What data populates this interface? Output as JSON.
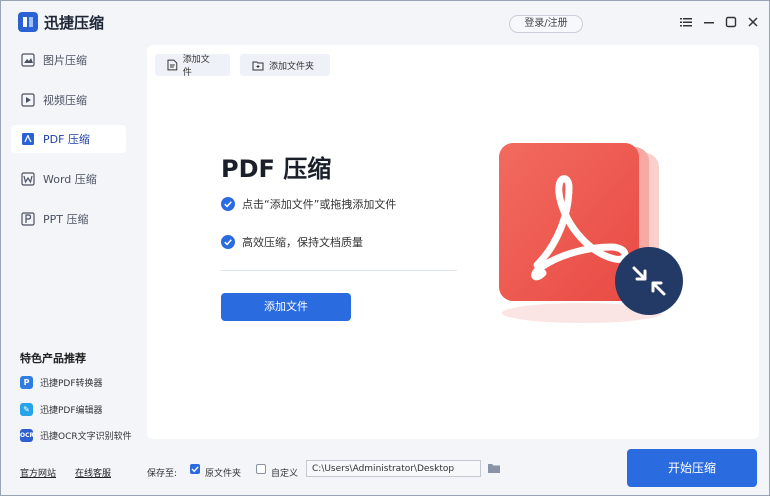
{
  "app": {
    "title": "迅捷压缩",
    "login_label": "登录/注册"
  },
  "sidebar": {
    "items": [
      {
        "label": "图片压缩",
        "icon": "image-compress-icon"
      },
      {
        "label": "视频压缩",
        "icon": "video-compress-icon"
      },
      {
        "label": "PDF 压缩",
        "icon": "pdf-compress-icon",
        "active": true
      },
      {
        "label": "Word 压缩",
        "icon": "word-compress-icon"
      },
      {
        "label": "PPT 压缩",
        "icon": "ppt-compress-icon"
      }
    ],
    "recommend_title": "特色产品推荐",
    "recommend": [
      {
        "label": "迅捷PDF转换器",
        "icon": "pdf-converter-icon",
        "color": "#2f7de1"
      },
      {
        "label": "迅捷PDF编辑器",
        "icon": "pdf-editor-icon",
        "color": "#27a3e8"
      },
      {
        "label": "迅捷OCR文字识别软件",
        "icon": "ocr-icon",
        "color": "#2d5fcf"
      }
    ]
  },
  "toolbar": {
    "add_file": "添加文件",
    "add_folder": "添加文件夹"
  },
  "main": {
    "headline": "PDF 压缩",
    "features": [
      "点击“添加文件”或拖拽添加文件",
      "高效压缩，保持文档质量"
    ],
    "add_button": "添加文件"
  },
  "footer": {
    "link_official": "官方网站",
    "link_support": "在线客服",
    "save_to_label": "保存至:",
    "original_folder_label": "原文件夹",
    "original_folder_checked": true,
    "custom_label": "自定义",
    "custom_checked": false,
    "path_value": "C:\\Users\\Administrator\\Desktop",
    "start_button": "开始压缩"
  },
  "colors": {
    "accent": "#2a6be0",
    "pdf_red": "#ef5350",
    "badge_navy": "#243a66"
  }
}
